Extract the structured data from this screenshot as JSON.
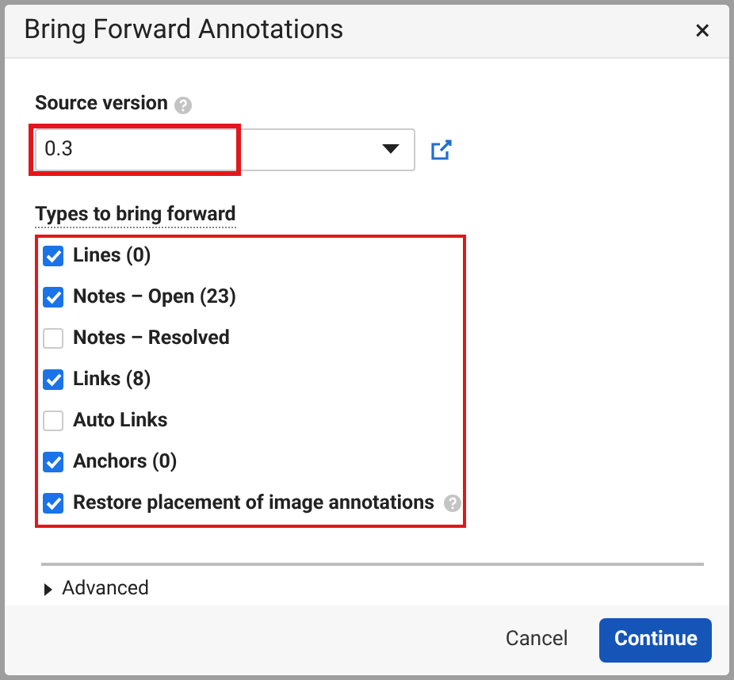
{
  "dialog": {
    "title": "Bring Forward Annotations",
    "close": "×"
  },
  "source_version": {
    "label": "Source version",
    "value": "0.3"
  },
  "types": {
    "label": "Types to bring forward",
    "items": [
      {
        "label": "Lines (0)",
        "checked": true
      },
      {
        "label": "Notes – Open (23)",
        "checked": true
      },
      {
        "label": "Notes – Resolved",
        "checked": false
      },
      {
        "label": "Links (8)",
        "checked": true
      },
      {
        "label": "Auto Links",
        "checked": false
      },
      {
        "label": "Anchors (0)",
        "checked": true
      },
      {
        "label": "Restore placement of image annotations",
        "checked": true,
        "help": true
      }
    ]
  },
  "advanced": {
    "label": "Advanced",
    "expanded": false
  },
  "buttons": [
    {
      "label": "Cancel",
      "kind": "secondary"
    },
    {
      "label": "Continue",
      "kind": "primary"
    }
  ]
}
